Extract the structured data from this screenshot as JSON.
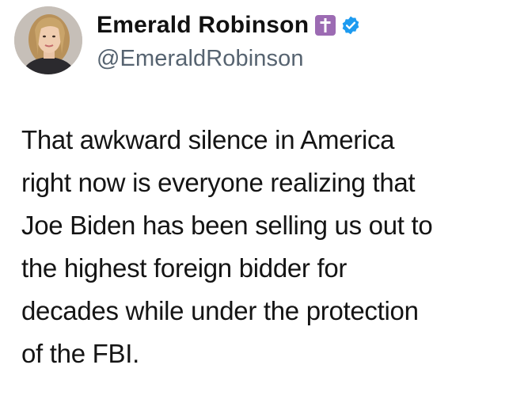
{
  "user": {
    "display_name": "Emerald Robinson",
    "handle": "@EmeraldRobinson",
    "avatar_icon": "profile-photo",
    "cross_badge_icon": "latin-cross-icon",
    "verified_badge_icon": "verified-check-icon"
  },
  "tweet": {
    "lines": [
      "That awkward silence in America",
      "right now is everyone realizing that",
      "Joe Biden has been selling us out to",
      "the highest foreign bidder for",
      "decades while under the protection",
      "of the FBI."
    ]
  },
  "colors": {
    "cross_badge": "#9c6bb3",
    "verified_badge": "#1d9bf0",
    "handle": "#566370",
    "text": "#141414"
  }
}
